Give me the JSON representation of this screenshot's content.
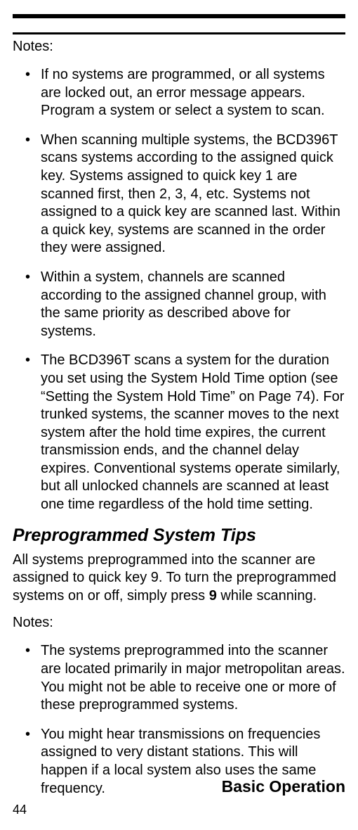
{
  "notesLabel1": "Notes:",
  "bullets1": [
    "If no systems are programmed, or all systems are locked out, an error message appears. Program a system or select a system to scan.",
    "When scanning multiple systems, the BCD396T scans systems according to the assigned quick key. Systems assigned to quick key 1 are scanned first, then 2, 3, 4, etc. Systems not assigned to a quick key are scanned last. Within a quick key, systems are scanned in the order they were assigned.",
    "Within a system, channels are scanned according to the assigned channel group, with the same priority as described above for systems.",
    "The BCD396T scans a system for the duration you set using the System Hold Time option (see “Setting the System Hold Time” on Page 74). For trunked systems, the scanner moves to the next system after the hold time expires, the current transmission ends, and the channel delay expires. Conventional systems operate similarly, but all unlocked channels are scanned at least one time regardless of the hold time setting."
  ],
  "sectionHeading": "Preprogrammed System Tips",
  "paragraphPart1": "All systems preprogrammed into the scanner are assigned to quick key 9. To turn the preprogrammed systems on or off, simply press ",
  "paragraphBold": "9",
  "paragraphPart2": " while scanning.",
  "notesLabel2": "Notes:",
  "bullets2": [
    "The systems preprogrammed into the scanner are located primarily in major metropolitan areas. You might not be able to receive one or more of these preprogrammed systems.",
    "You might hear transmissions on frequencies assigned to very distant stations. This will happen if a local system also uses the same frequency."
  ],
  "footerTitle": "Basic Operation",
  "pageNumber": "44"
}
